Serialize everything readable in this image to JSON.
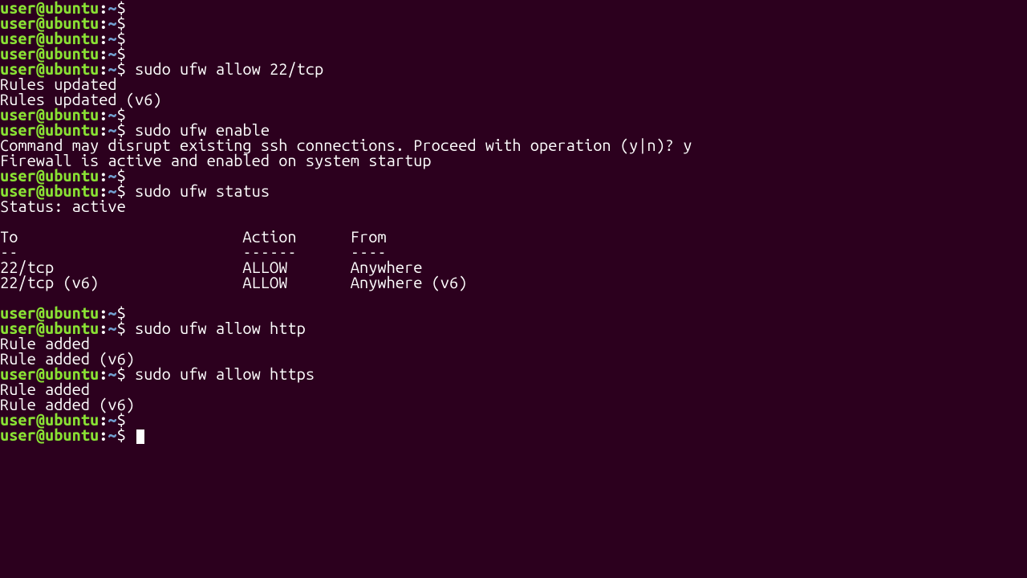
{
  "prompt": {
    "user": "user",
    "at": "@",
    "host": "ubuntu",
    "colon": ":",
    "path": "~",
    "symbol": "$"
  },
  "lines": [
    {
      "type": "prompt",
      "cmd": ""
    },
    {
      "type": "prompt",
      "cmd": ""
    },
    {
      "type": "prompt",
      "cmd": ""
    },
    {
      "type": "prompt",
      "cmd": ""
    },
    {
      "type": "prompt",
      "cmd": "sudo ufw allow 22/tcp"
    },
    {
      "type": "output",
      "text": "Rules updated"
    },
    {
      "type": "output",
      "text": "Rules updated (v6)"
    },
    {
      "type": "prompt",
      "cmd": ""
    },
    {
      "type": "prompt",
      "cmd": "sudo ufw enable"
    },
    {
      "type": "output",
      "text": "Command may disrupt existing ssh connections. Proceed with operation (y|n)? y"
    },
    {
      "type": "output",
      "text": "Firewall is active and enabled on system startup"
    },
    {
      "type": "prompt",
      "cmd": ""
    },
    {
      "type": "prompt",
      "cmd": "sudo ufw status"
    },
    {
      "type": "output",
      "text": "Status: active"
    },
    {
      "type": "output",
      "text": ""
    },
    {
      "type": "output",
      "text": "To                         Action      From"
    },
    {
      "type": "output",
      "text": "--                         ------      ----"
    },
    {
      "type": "output",
      "text": "22/tcp                     ALLOW       Anywhere"
    },
    {
      "type": "output",
      "text": "22/tcp (v6)                ALLOW       Anywhere (v6)"
    },
    {
      "type": "output",
      "text": ""
    },
    {
      "type": "prompt",
      "cmd": ""
    },
    {
      "type": "prompt",
      "cmd": "sudo ufw allow http"
    },
    {
      "type": "output",
      "text": "Rule added"
    },
    {
      "type": "output",
      "text": "Rule added (v6)"
    },
    {
      "type": "prompt",
      "cmd": "sudo ufw allow https"
    },
    {
      "type": "output",
      "text": "Rule added"
    },
    {
      "type": "output",
      "text": "Rule added (v6)"
    },
    {
      "type": "prompt",
      "cmd": ""
    },
    {
      "type": "prompt",
      "cmd": "",
      "cursor": true
    }
  ]
}
